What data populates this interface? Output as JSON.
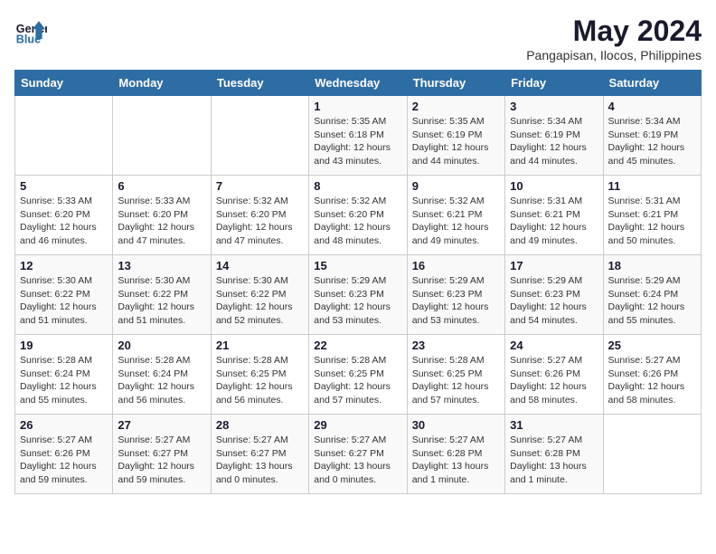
{
  "logo": {
    "line1": "General",
    "line2": "Blue"
  },
  "title": "May 2024",
  "subtitle": "Pangapisan, Ilocos, Philippines",
  "days_of_week": [
    "Sunday",
    "Monday",
    "Tuesday",
    "Wednesday",
    "Thursday",
    "Friday",
    "Saturday"
  ],
  "weeks": [
    [
      {
        "day": "",
        "info": ""
      },
      {
        "day": "",
        "info": ""
      },
      {
        "day": "",
        "info": ""
      },
      {
        "day": "1",
        "info": "Sunrise: 5:35 AM\nSunset: 6:18 PM\nDaylight: 12 hours\nand 43 minutes."
      },
      {
        "day": "2",
        "info": "Sunrise: 5:35 AM\nSunset: 6:19 PM\nDaylight: 12 hours\nand 44 minutes."
      },
      {
        "day": "3",
        "info": "Sunrise: 5:34 AM\nSunset: 6:19 PM\nDaylight: 12 hours\nand 44 minutes."
      },
      {
        "day": "4",
        "info": "Sunrise: 5:34 AM\nSunset: 6:19 PM\nDaylight: 12 hours\nand 45 minutes."
      }
    ],
    [
      {
        "day": "5",
        "info": "Sunrise: 5:33 AM\nSunset: 6:20 PM\nDaylight: 12 hours\nand 46 minutes."
      },
      {
        "day": "6",
        "info": "Sunrise: 5:33 AM\nSunset: 6:20 PM\nDaylight: 12 hours\nand 47 minutes."
      },
      {
        "day": "7",
        "info": "Sunrise: 5:32 AM\nSunset: 6:20 PM\nDaylight: 12 hours\nand 47 minutes."
      },
      {
        "day": "8",
        "info": "Sunrise: 5:32 AM\nSunset: 6:20 PM\nDaylight: 12 hours\nand 48 minutes."
      },
      {
        "day": "9",
        "info": "Sunrise: 5:32 AM\nSunset: 6:21 PM\nDaylight: 12 hours\nand 49 minutes."
      },
      {
        "day": "10",
        "info": "Sunrise: 5:31 AM\nSunset: 6:21 PM\nDaylight: 12 hours\nand 49 minutes."
      },
      {
        "day": "11",
        "info": "Sunrise: 5:31 AM\nSunset: 6:21 PM\nDaylight: 12 hours\nand 50 minutes."
      }
    ],
    [
      {
        "day": "12",
        "info": "Sunrise: 5:30 AM\nSunset: 6:22 PM\nDaylight: 12 hours\nand 51 minutes."
      },
      {
        "day": "13",
        "info": "Sunrise: 5:30 AM\nSunset: 6:22 PM\nDaylight: 12 hours\nand 51 minutes."
      },
      {
        "day": "14",
        "info": "Sunrise: 5:30 AM\nSunset: 6:22 PM\nDaylight: 12 hours\nand 52 minutes."
      },
      {
        "day": "15",
        "info": "Sunrise: 5:29 AM\nSunset: 6:23 PM\nDaylight: 12 hours\nand 53 minutes."
      },
      {
        "day": "16",
        "info": "Sunrise: 5:29 AM\nSunset: 6:23 PM\nDaylight: 12 hours\nand 53 minutes."
      },
      {
        "day": "17",
        "info": "Sunrise: 5:29 AM\nSunset: 6:23 PM\nDaylight: 12 hours\nand 54 minutes."
      },
      {
        "day": "18",
        "info": "Sunrise: 5:29 AM\nSunset: 6:24 PM\nDaylight: 12 hours\nand 55 minutes."
      }
    ],
    [
      {
        "day": "19",
        "info": "Sunrise: 5:28 AM\nSunset: 6:24 PM\nDaylight: 12 hours\nand 55 minutes."
      },
      {
        "day": "20",
        "info": "Sunrise: 5:28 AM\nSunset: 6:24 PM\nDaylight: 12 hours\nand 56 minutes."
      },
      {
        "day": "21",
        "info": "Sunrise: 5:28 AM\nSunset: 6:25 PM\nDaylight: 12 hours\nand 56 minutes."
      },
      {
        "day": "22",
        "info": "Sunrise: 5:28 AM\nSunset: 6:25 PM\nDaylight: 12 hours\nand 57 minutes."
      },
      {
        "day": "23",
        "info": "Sunrise: 5:28 AM\nSunset: 6:25 PM\nDaylight: 12 hours\nand 57 minutes."
      },
      {
        "day": "24",
        "info": "Sunrise: 5:27 AM\nSunset: 6:26 PM\nDaylight: 12 hours\nand 58 minutes."
      },
      {
        "day": "25",
        "info": "Sunrise: 5:27 AM\nSunset: 6:26 PM\nDaylight: 12 hours\nand 58 minutes."
      }
    ],
    [
      {
        "day": "26",
        "info": "Sunrise: 5:27 AM\nSunset: 6:26 PM\nDaylight: 12 hours\nand 59 minutes."
      },
      {
        "day": "27",
        "info": "Sunrise: 5:27 AM\nSunset: 6:27 PM\nDaylight: 12 hours\nand 59 minutes."
      },
      {
        "day": "28",
        "info": "Sunrise: 5:27 AM\nSunset: 6:27 PM\nDaylight: 13 hours\nand 0 minutes."
      },
      {
        "day": "29",
        "info": "Sunrise: 5:27 AM\nSunset: 6:27 PM\nDaylight: 13 hours\nand 0 minutes."
      },
      {
        "day": "30",
        "info": "Sunrise: 5:27 AM\nSunset: 6:28 PM\nDaylight: 13 hours\nand 1 minute."
      },
      {
        "day": "31",
        "info": "Sunrise: 5:27 AM\nSunset: 6:28 PM\nDaylight: 13 hours\nand 1 minute."
      },
      {
        "day": "",
        "info": ""
      }
    ]
  ]
}
